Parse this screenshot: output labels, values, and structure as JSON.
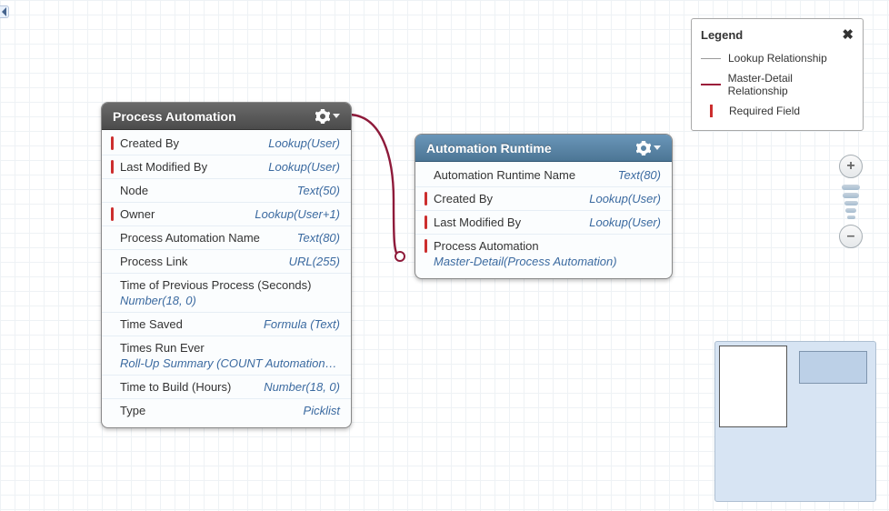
{
  "panels": {
    "processAutomation": {
      "title": "Process Automation",
      "fields": [
        {
          "name": "Created By",
          "type": "Lookup(User)",
          "required": true
        },
        {
          "name": "Last Modified By",
          "type": "Lookup(User)",
          "required": true
        },
        {
          "name": "Node",
          "type": "Text(50)",
          "required": false
        },
        {
          "name": "Owner",
          "type": "Lookup(User+1)",
          "required": true
        },
        {
          "name": "Process Automation Name",
          "type": "Text(80)",
          "required": false
        },
        {
          "name": "Process Link",
          "type": "URL(255)",
          "required": false
        },
        {
          "name": "Time of Previous Process (Seconds)",
          "type": "Number(18, 0)",
          "required": false,
          "wrap": true
        },
        {
          "name": "Time Saved",
          "type": "Formula (Text)",
          "required": false
        },
        {
          "name": "Times Run Ever",
          "type": "Roll-Up Summary (COUNT Automation Run",
          "required": false,
          "wrap": true
        },
        {
          "name": "Time to Build (Hours)",
          "type": "Number(18, 0)",
          "required": false
        },
        {
          "name": "Type",
          "type": "Picklist",
          "required": false
        }
      ]
    },
    "automationRuntime": {
      "title": "Automation Runtime",
      "fields": [
        {
          "name": "Automation Runtime Name",
          "type": "Text(80)",
          "required": false
        },
        {
          "name": "Created By",
          "type": "Lookup(User)",
          "required": true
        },
        {
          "name": "Last Modified By",
          "type": "Lookup(User)",
          "required": true
        },
        {
          "name": "Process Automation",
          "type": "Master-Detail(Process Automation)",
          "required": true,
          "wrap": true
        }
      ]
    }
  },
  "legend": {
    "title": "Legend",
    "items": {
      "lookup": "Lookup Relationship",
      "master": "Master-Detail Relationship",
      "required": "Required Field"
    }
  },
  "zoom": {
    "plus": "+",
    "minus": "–"
  }
}
